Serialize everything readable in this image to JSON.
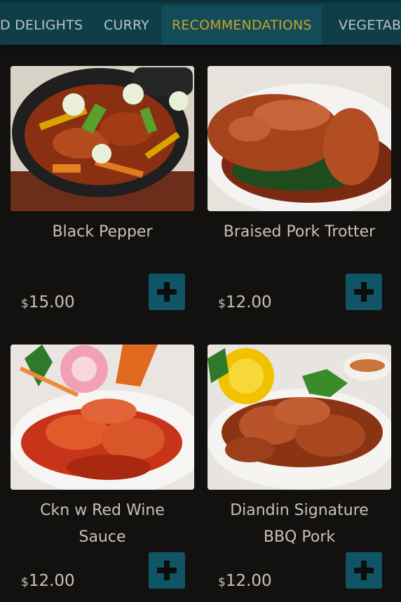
{
  "tabs": [
    {
      "label": "D DELIGHTS",
      "active": false
    },
    {
      "label": "CURRY",
      "active": false
    },
    {
      "label": "RECOMMENDATIONS",
      "active": true
    },
    {
      "label": "VEGETAB",
      "active": false
    }
  ],
  "menu_items": [
    {
      "name": "Black Pepper",
      "currency": "$",
      "price": "15.00"
    },
    {
      "name": "Braised Pork Trotter",
      "currency": "$",
      "price": "12.00"
    },
    {
      "name_line1": "Ckn w Red Wine",
      "name_line2": "Sauce",
      "currency": "$",
      "price": "12.00"
    },
    {
      "name_line1": "Diandin Signature",
      "name_line2": "BBQ Pork",
      "currency": "$",
      "price": "12.00"
    }
  ],
  "colors": {
    "accent_tab_active": "#c9a227",
    "tabbar_bg": "#0f3e49",
    "add_button_bg": "#0f5565",
    "page_bg": "#121110"
  },
  "icons": {
    "add": "plus-icon"
  }
}
